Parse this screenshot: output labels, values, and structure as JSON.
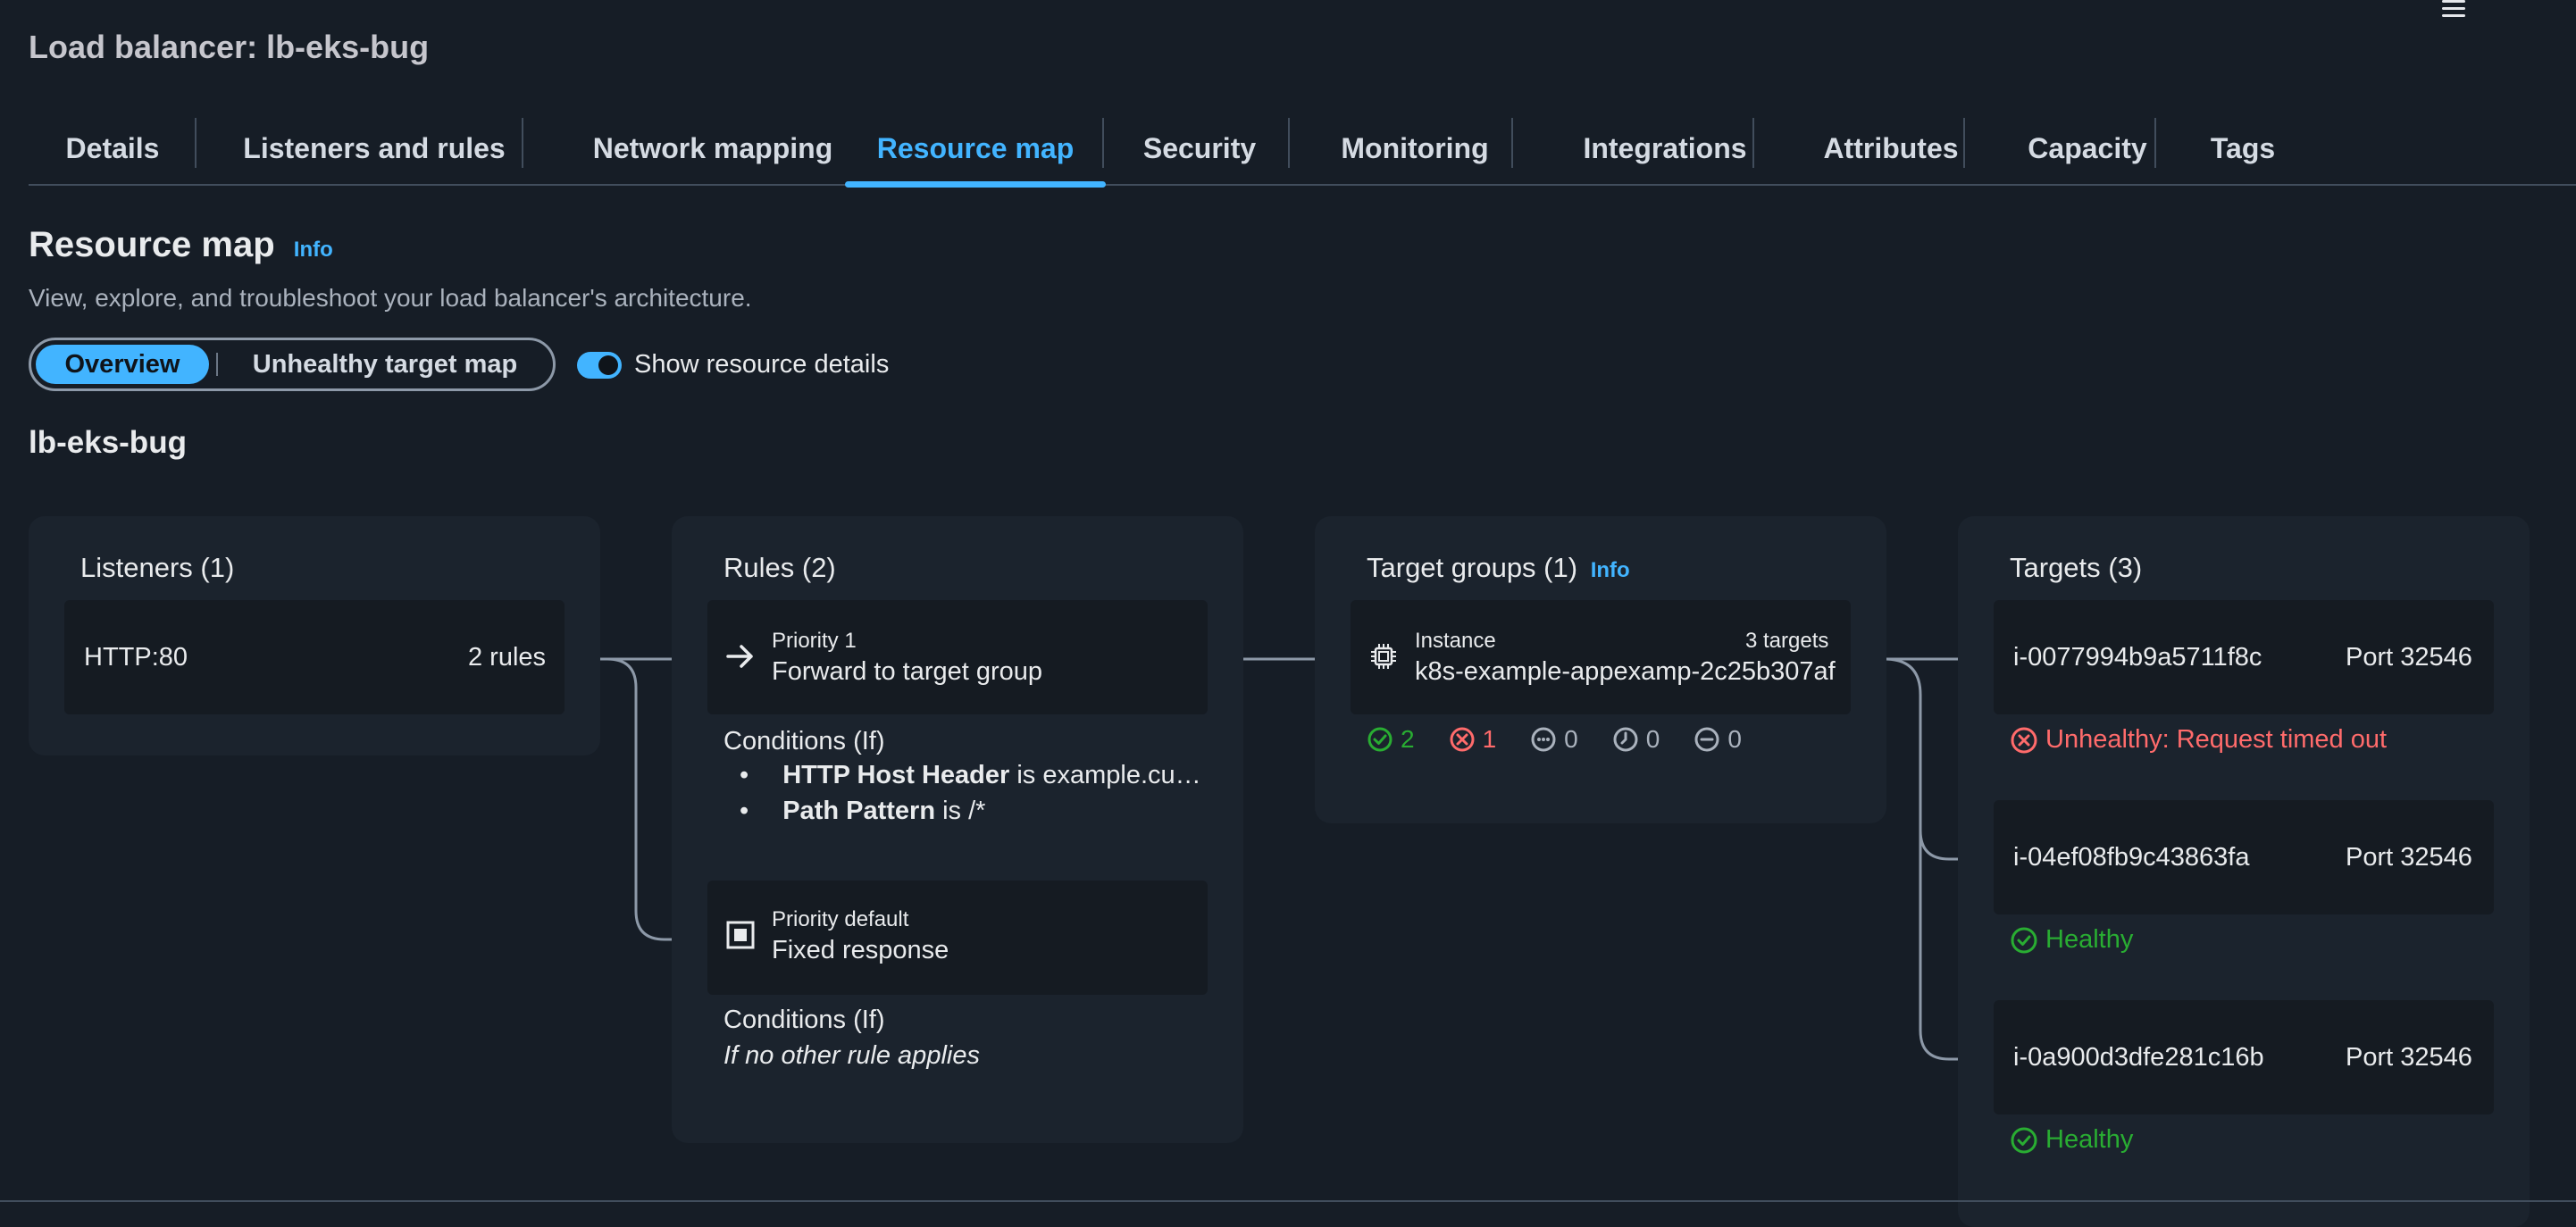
{
  "header": {
    "title": "Load balancer: lb-eks-bug"
  },
  "tabs": [
    "Details",
    "Listeners and rules",
    "Network mapping",
    "Resource map",
    "Security",
    "Monitoring",
    "Integrations",
    "Attributes",
    "Capacity",
    "Tags"
  ],
  "active_tab": "Resource map",
  "section": {
    "title": "Resource map",
    "info": "Info",
    "description": "View, explore, and troubleshoot your load balancer's architecture."
  },
  "view_toggle": {
    "overview": "Overview",
    "unhealthy": "Unhealthy target map"
  },
  "show_details": {
    "label": "Show resource details",
    "enabled": true
  },
  "lb_name": "lb-eks-bug",
  "listeners": {
    "title": "Listeners (1)",
    "items": [
      {
        "name": "HTTP:80",
        "rules": "2 rules"
      }
    ]
  },
  "rules": {
    "title": "Rules (2)",
    "items": [
      {
        "priority": "Priority 1",
        "action": "Forward to target group",
        "conditions_title": "Conditions (If)",
        "conditions": [
          {
            "key": "HTTP Host Header",
            "op": " is ",
            "value": "example.cu…"
          },
          {
            "key": "Path Pattern",
            "op": " is ",
            "value": "/*"
          }
        ]
      },
      {
        "priority": "Priority default",
        "action": "Fixed response",
        "conditions_title": "Conditions (If)",
        "conditions_text": "If no other rule applies"
      }
    ]
  },
  "target_groups": {
    "title": "Target groups (1)",
    "info": "Info",
    "items": [
      {
        "type": "Instance",
        "targets": "3 targets",
        "name": "k8s-example-appexamp-2c25b307af",
        "counts": {
          "healthy": "2",
          "unhealthy": "1",
          "unused": "0",
          "initial": "0",
          "draining": "0"
        }
      }
    ]
  },
  "targets": {
    "title": "Targets (3)",
    "items": [
      {
        "id": "i-0077994b9a5711f8c",
        "port": "Port 32546",
        "status": "Unhealthy: Request timed out",
        "health": "unhealthy"
      },
      {
        "id": "i-04ef08fb9c43863fa",
        "port": "Port 32546",
        "status": "Healthy",
        "health": "healthy"
      },
      {
        "id": "i-0a900d3dfe281c16b",
        "port": "Port 32546",
        "status": "Healthy",
        "health": "healthy"
      }
    ]
  },
  "colors": {
    "background": "#161d26",
    "accent": "#42b4ff",
    "healthy": "#29ad32",
    "unhealthy": "#ff6b6b"
  },
  "icons": [
    "menu-icon",
    "arrow-right-icon",
    "stop-icon",
    "chip-icon",
    "check-circle-icon",
    "x-circle-icon",
    "ellipsis-circle-icon",
    "clock-circle-icon",
    "minus-circle-icon"
  ]
}
